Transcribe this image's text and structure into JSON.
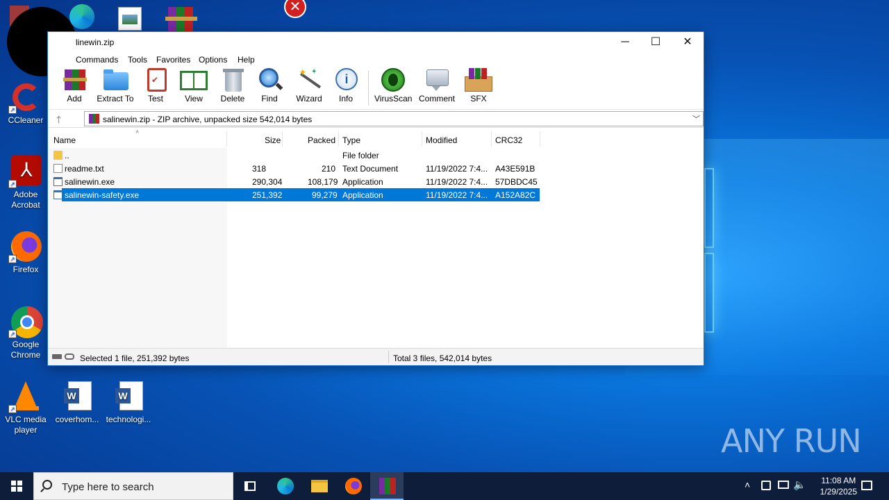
{
  "window": {
    "title": "salinewin.zip",
    "title_visible": "linewin.zip",
    "minimize_icon": "minimize-icon",
    "maximize_icon": "maximize-icon",
    "close_icon": "close-icon"
  },
  "menu": [
    "Commands",
    "Tools",
    "Favorites",
    "Options",
    "Help"
  ],
  "toolbar": [
    {
      "label": "Add",
      "icon": "add-archive-icon"
    },
    {
      "label": "Extract To",
      "icon": "extract-folder-icon"
    },
    {
      "label": "Test",
      "icon": "test-clipboard-icon"
    },
    {
      "label": "View",
      "icon": "view-book-icon"
    },
    {
      "label": "Delete",
      "icon": "trash-icon"
    },
    {
      "label": "Find",
      "icon": "magnifier-icon"
    },
    {
      "label": "Wizard",
      "icon": "wand-icon"
    },
    {
      "label": "Info",
      "icon": "info-icon"
    },
    {
      "label": "VirusScan",
      "icon": "bug-icon"
    },
    {
      "label": "Comment",
      "icon": "comment-icon"
    },
    {
      "label": "SFX",
      "icon": "sfx-box-icon"
    }
  ],
  "address": {
    "text": "salinewin.zip - ZIP archive, unpacked size 542,014 bytes"
  },
  "columns": [
    "Name",
    "Size",
    "Packed",
    "Type",
    "Modified",
    "CRC32"
  ],
  "files": [
    {
      "name": "..",
      "size": "",
      "packed": "",
      "type": "File folder",
      "modified": "",
      "crc": "",
      "icon": "folder-icon"
    },
    {
      "name": "readme.txt",
      "size": "318",
      "packed": "210",
      "type": "Text Document",
      "modified": "11/19/2022 7:4...",
      "crc": "A43E591B",
      "icon": "text-file-icon"
    },
    {
      "name": "salinewin.exe",
      "size": "290,304",
      "packed": "108,179",
      "type": "Application",
      "modified": "11/19/2022 7:4...",
      "crc": "57DBDC45",
      "icon": "exe-file-icon"
    },
    {
      "name": "salinewin-safety.exe",
      "size": "251,392",
      "packed": "99,279",
      "type": "Application",
      "modified": "11/19/2022 7:4...",
      "crc": "A152A82C",
      "icon": "exe-file-icon",
      "selected": true
    }
  ],
  "status": {
    "left": "Selected 1 file, 251,392 bytes",
    "right": "Total 3 files, 542,014 bytes"
  },
  "desktop_icons": [
    {
      "label": "CCleaner"
    },
    {
      "label": "Adobe Acrobat"
    },
    {
      "label": "Firefox"
    },
    {
      "label": "Google Chrome"
    },
    {
      "label": "VLC media player"
    },
    {
      "label": "coverhom..."
    },
    {
      "label": "technologi..."
    }
  ],
  "taskbar": {
    "search_placeholder": "Type here to search",
    "time": "11:08 AM",
    "date": "1/29/2025"
  },
  "watermark": "ANY RUN",
  "colors": {
    "selection": "#0078d7",
    "taskbar": "#0e1d3a"
  }
}
